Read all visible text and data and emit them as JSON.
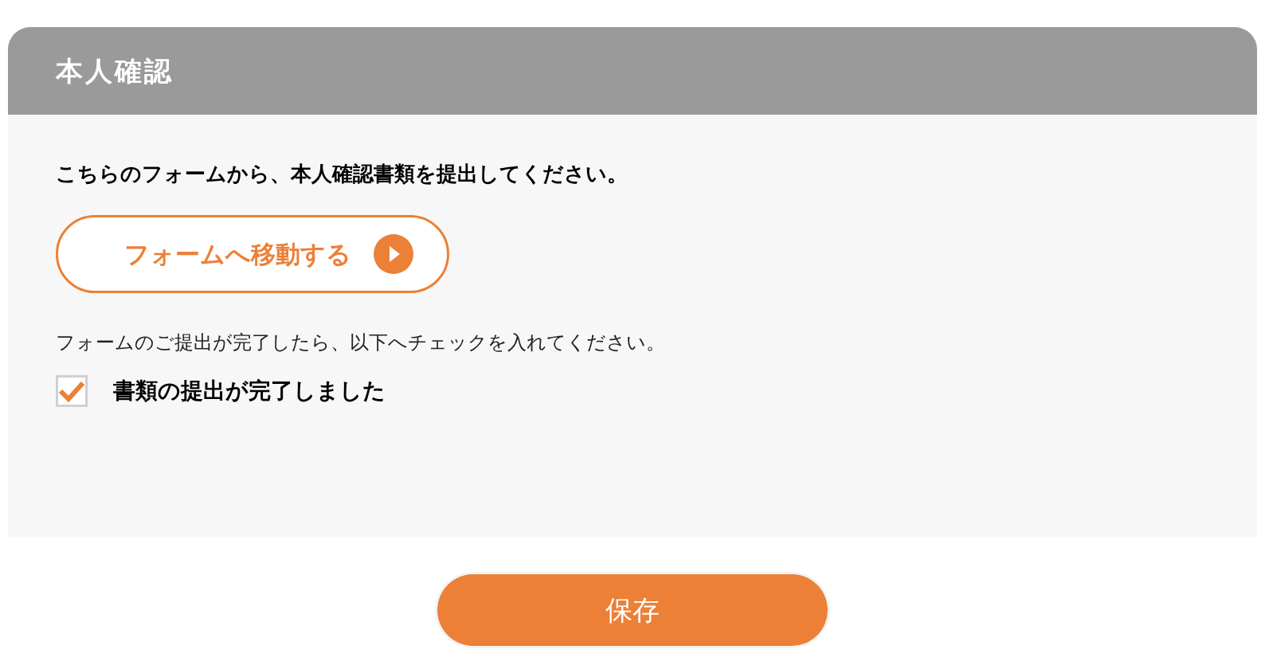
{
  "panel": {
    "title": "本人確認"
  },
  "instruction": "こちらのフォームから、本人確認書類を提出してください。",
  "form_link": {
    "label": "フォームへ移動する"
  },
  "note": "フォームのご提出が完了したら、以下へチェックを入れてください。",
  "checkbox": {
    "label": "書類の提出が完了しました",
    "checked": true
  },
  "buttons": [
    {
      "label": "保存"
    }
  ]
}
